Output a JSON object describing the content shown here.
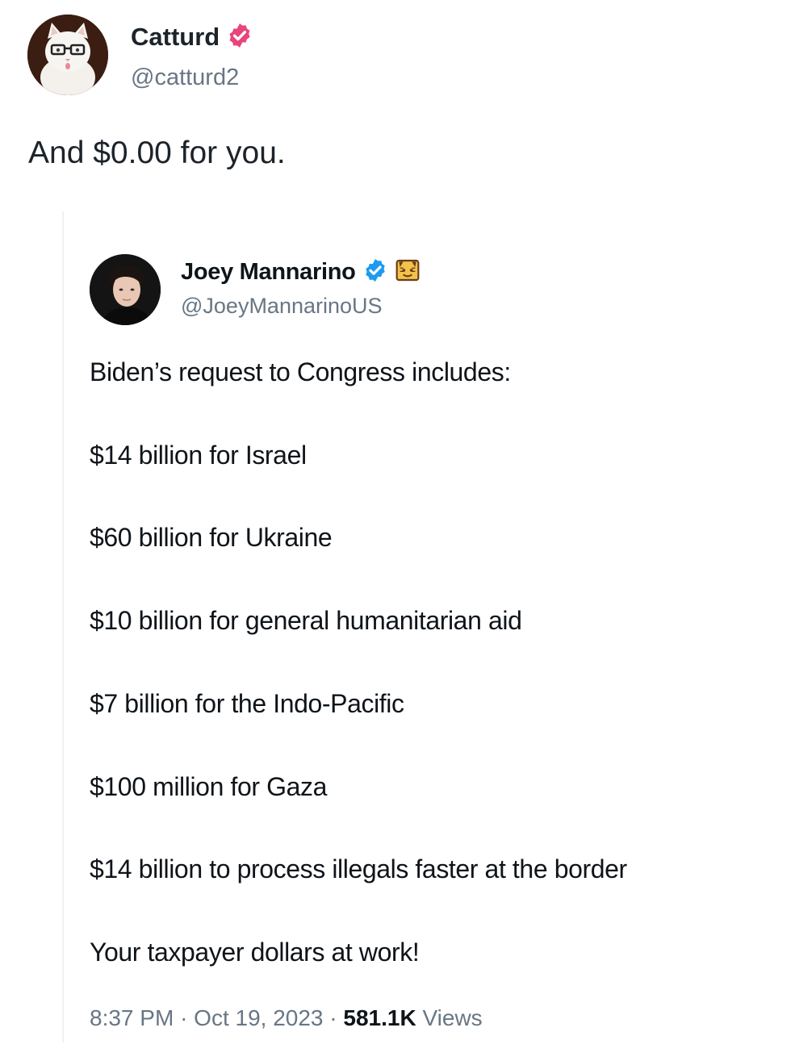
{
  "outer_tweet": {
    "author_name": "Catturd",
    "handle": "@catturd2",
    "text": "And $0.00 for you.",
    "badge_color": "#e0245e",
    "avatar_icon": "cat-with-glasses-avatar"
  },
  "quoted_tweet": {
    "author_name": "Joey Mannarino",
    "handle": "@JoeyMannarinoUS",
    "badge_color": "#1d9bf0",
    "affiliate_icon": "cat-face-emoji-icon",
    "avatar_icon": "man-portrait-avatar",
    "lines": [
      "Biden’s request to Congress includes:",
      "$14 billion for Israel",
      "$60 billion for Ukraine",
      "$10 billion for general humanitarian aid",
      "$7 billion for the Indo-Pacific",
      "$100 million for Gaza",
      "$14 billion to process illegals faster at the border",
      "Your taxpayer dollars at work!"
    ],
    "time": "8:37 PM",
    "separator": "·",
    "date": "Oct 19, 2023",
    "views_count": "581.1K",
    "views_label": "Views"
  }
}
